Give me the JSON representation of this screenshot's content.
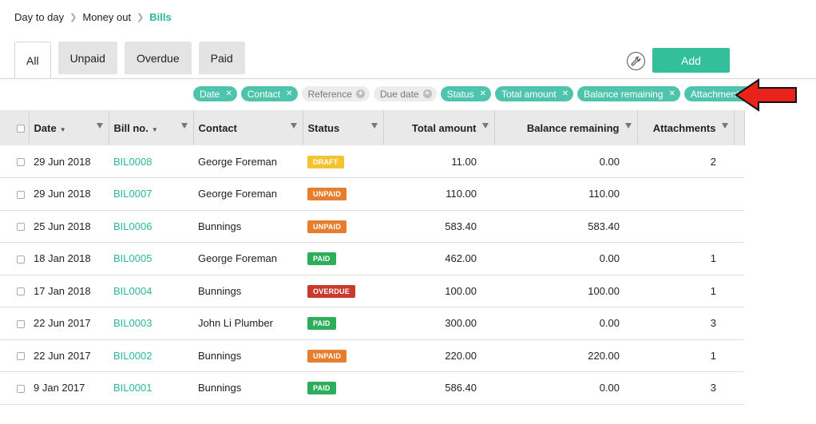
{
  "breadcrumb": {
    "items": [
      "Day to day",
      "Money out"
    ],
    "current": "Bills"
  },
  "tabs": [
    {
      "label": "All",
      "active": true
    },
    {
      "label": "Unpaid",
      "active": false
    },
    {
      "label": "Overdue",
      "active": false
    },
    {
      "label": "Paid",
      "active": false
    }
  ],
  "toolbar": {
    "settings_icon": "wrench-icon",
    "add_label": "Add"
  },
  "column_chips": [
    {
      "label": "Date",
      "on": true
    },
    {
      "label": "Contact",
      "on": true
    },
    {
      "label": "Reference",
      "on": false
    },
    {
      "label": "Due date",
      "on": false
    },
    {
      "label": "Status",
      "on": true
    },
    {
      "label": "Total amount",
      "on": true
    },
    {
      "label": "Balance remaining",
      "on": true
    },
    {
      "label": "Attachments",
      "on": true
    }
  ],
  "table": {
    "columns": [
      "Date",
      "Bill no.",
      "Contact",
      "Status",
      "Total amount",
      "Balance remaining",
      "Attachments"
    ],
    "rows": [
      {
        "date": "29 Jun 2018",
        "bill_no": "BIL0008",
        "contact": "George Foreman",
        "status": "DRAFT",
        "status_kind": "draft",
        "total": "11.00",
        "balance": "0.00",
        "attachments": "2"
      },
      {
        "date": "29 Jun 2018",
        "bill_no": "BIL0007",
        "contact": "George Foreman",
        "status": "UNPAID",
        "status_kind": "unpaid",
        "total": "110.00",
        "balance": "110.00",
        "attachments": ""
      },
      {
        "date": "25 Jun 2018",
        "bill_no": "BIL0006",
        "contact": "Bunnings",
        "status": "UNPAID",
        "status_kind": "unpaid",
        "total": "583.40",
        "balance": "583.40",
        "attachments": ""
      },
      {
        "date": "18 Jan 2018",
        "bill_no": "BIL0005",
        "contact": "George Foreman",
        "status": "PAID",
        "status_kind": "paid",
        "total": "462.00",
        "balance": "0.00",
        "attachments": "1"
      },
      {
        "date": "17 Jan 2018",
        "bill_no": "BIL0004",
        "contact": "Bunnings",
        "status": "OVERDUE",
        "status_kind": "overdue",
        "total": "100.00",
        "balance": "100.00",
        "attachments": "1"
      },
      {
        "date": "22 Jun 2017",
        "bill_no": "BIL0003",
        "contact": "John Li Plumber",
        "status": "PAID",
        "status_kind": "paid",
        "total": "300.00",
        "balance": "0.00",
        "attachments": "3"
      },
      {
        "date": "22 Jun 2017",
        "bill_no": "BIL0002",
        "contact": "Bunnings",
        "status": "UNPAID",
        "status_kind": "unpaid",
        "total": "220.00",
        "balance": "220.00",
        "attachments": "1"
      },
      {
        "date": "9 Jan 2017",
        "bill_no": "BIL0001",
        "contact": "Bunnings",
        "status": "PAID",
        "status_kind": "paid",
        "total": "586.40",
        "balance": "0.00",
        "attachments": "3"
      }
    ]
  },
  "colors": {
    "accent": "#33bf9a",
    "link": "#2bb79a",
    "arrow": "#e8231b"
  }
}
